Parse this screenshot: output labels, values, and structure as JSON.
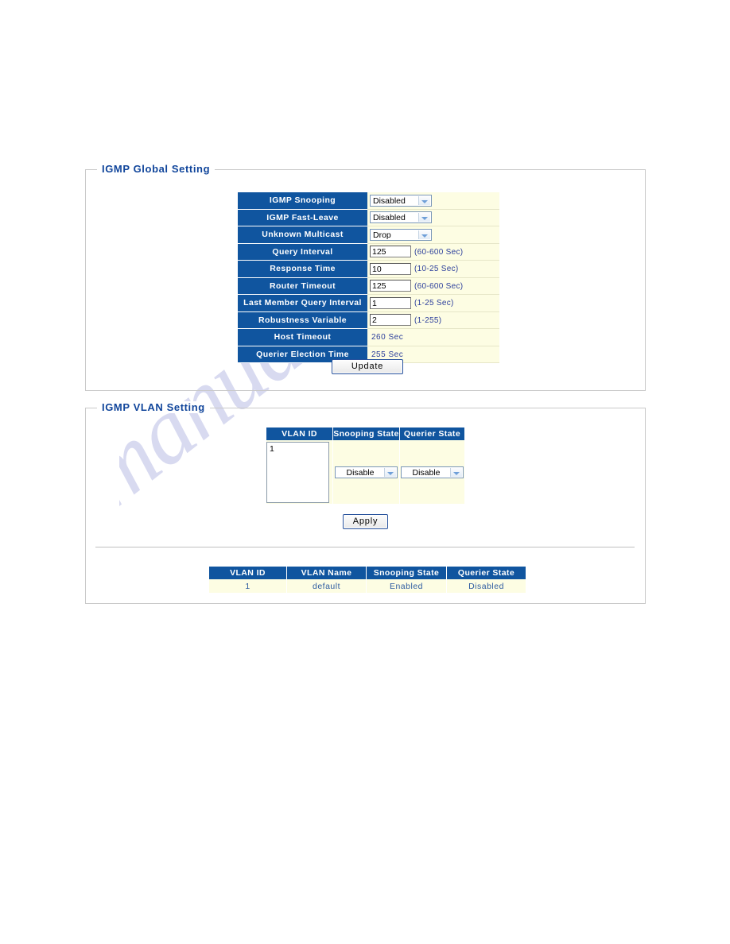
{
  "watermark": {
    "text": "manualshive.com"
  },
  "global_panel": {
    "legend": "IGMP Global Setting",
    "rows": [
      {
        "label": "IGMP Snooping",
        "type": "select",
        "value": "Disabled",
        "hint": ""
      },
      {
        "label": "IGMP Fast-Leave",
        "type": "select",
        "value": "Disabled",
        "hint": ""
      },
      {
        "label": "Unknown Multicast",
        "type": "select",
        "value": "Drop",
        "hint": ""
      },
      {
        "label": "Query Interval",
        "type": "input",
        "value": "125",
        "hint": "(60-600 Sec)"
      },
      {
        "label": "Response Time",
        "type": "input",
        "value": "10",
        "hint": "(10-25 Sec)"
      },
      {
        "label": "Router Timeout",
        "type": "input",
        "value": "125",
        "hint": "(60-600 Sec)"
      },
      {
        "label": "Last Member Query Interval",
        "type": "input",
        "value": "1",
        "hint": "(1-25 Sec)"
      },
      {
        "label": "Robustness Variable",
        "type": "input",
        "value": "2",
        "hint": "(1-255)"
      },
      {
        "label": "Host Timeout",
        "type": "static",
        "value": "260 Sec",
        "hint": ""
      },
      {
        "label": "Querier Election Time",
        "type": "static",
        "value": "255 Sec",
        "hint": ""
      }
    ],
    "update_label": "Update"
  },
  "vlan_panel": {
    "legend": "IGMP VLAN Setting",
    "headers": [
      "VLAN ID",
      "Snooping State",
      "Querier State"
    ],
    "vlan_id_list": [
      "1"
    ],
    "snooping_state": "Disable",
    "querier_state": "Disable",
    "apply_label": "Apply",
    "result_headers": [
      "VLAN ID",
      "VLAN Name",
      "Snooping State",
      "Querier State"
    ],
    "result_rows": [
      [
        "1",
        "default",
        "Enabled",
        "Disabled"
      ]
    ]
  },
  "colors": {
    "header_blue": "#10559f",
    "cell_cream": "#fdfde3",
    "legend_blue": "#10459b",
    "value_text_blue": "#2c5aa0"
  }
}
